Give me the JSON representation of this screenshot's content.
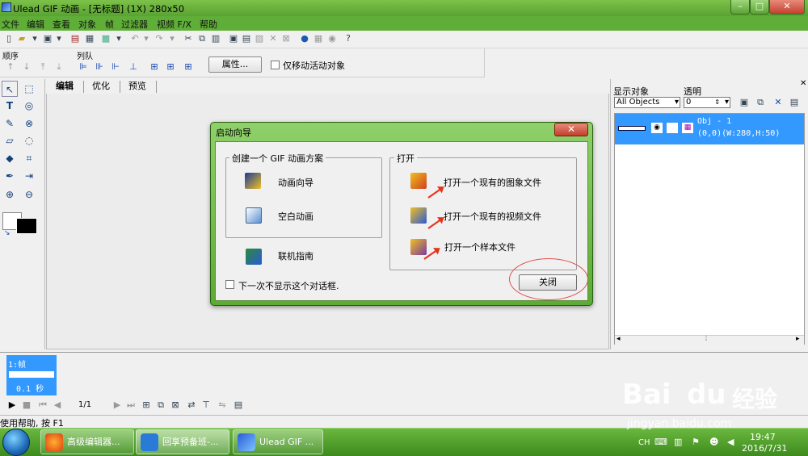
{
  "window": {
    "title": "Ulead GIF 动画 - [无标题] (1X) 280x50",
    "controls": [
      "–",
      "□",
      "✕"
    ]
  },
  "menu": [
    "文件",
    "编辑",
    "查看",
    "对象",
    "帧",
    "过滤器",
    "视频 F/X",
    "帮助"
  ],
  "toolbar2": {
    "order_label": "顺序",
    "queue_label": "列队",
    "properties_button": "属性...",
    "move_active_only": "仅移动活动对象"
  },
  "tabs": [
    "编辑",
    "优化",
    "预览"
  ],
  "right_pane": {
    "show_objects_label": "显示对象",
    "opacity_label": "透明",
    "objects_filter": "All Objects",
    "opacity_value": "0",
    "object": {
      "name": "Obj - 1",
      "info": "(0,0)(W:280,H:50)"
    }
  },
  "frames": {
    "frame1_label": "1:帧",
    "frame1_delay": "0.1 秒",
    "counter": "1/1"
  },
  "status": "使用帮助, 按 F1",
  "taskbar": {
    "items": [
      "高级编辑器...",
      "回享预备班-...",
      "Ulead GIF ..."
    ],
    "time": "19:47",
    "date": "2016/7/31",
    "lang": "CH"
  },
  "dialog": {
    "title": "启动向导",
    "create_group": "创建一个 GIF 动画方案",
    "animation_wizard": "动画向导",
    "blank_animation": "空白动画",
    "online_guide": "联机指南",
    "open_group": "打开",
    "open_image": "打开一个现有的图象文件",
    "open_video": "打开一个现有的视频文件",
    "open_sample": "打开一个样本文件",
    "dont_show": "下一次不显示这个对话框.",
    "close_button": "关闭"
  },
  "watermark": {
    "brand": "Bai",
    "brand2": "du",
    "cn": "经验",
    "url": "jingyan.baidu.com"
  }
}
